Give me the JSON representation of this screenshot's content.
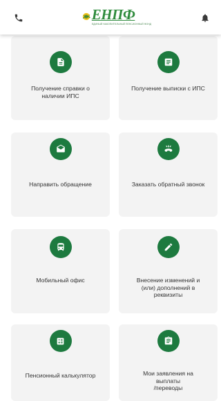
{
  "header": {
    "brand": "ЕНПФ",
    "tagline": "ЕДИНЫЙ НАКОПИТЕЛЬНЫЙ ПЕНСИОННЫЙ ФОНД",
    "phone_icon": "phone-icon",
    "bell_icon": "bell-icon"
  },
  "colors": {
    "accent": "#1d7a3f",
    "brand_green": "#2e8b3c",
    "brand_yellow": "#f2c21b",
    "card_bg": "#f3f3f3"
  },
  "cards": [
    {
      "label": "Получение справки о\nналичии ИПС",
      "icon": "document-icon"
    },
    {
      "label": "Получение выписки с ИПС",
      "icon": "statement-icon"
    },
    {
      "label": "Направить обращение",
      "icon": "envelope-icon"
    },
    {
      "label": "Заказать обратный звонок",
      "icon": "callback-phone-icon"
    },
    {
      "label": "Мобильный офис",
      "icon": "bus-icon"
    },
    {
      "label": "Внесение изменений и\n(или) дополнений в\nреквизиты",
      "icon": "pencil-icon"
    },
    {
      "label": "Пенсионный калькулятор",
      "icon": "calculator-icon"
    },
    {
      "label": "Мои заявления на\nвыплаты\n/переводы",
      "icon": "clipboard-icon"
    }
  ]
}
